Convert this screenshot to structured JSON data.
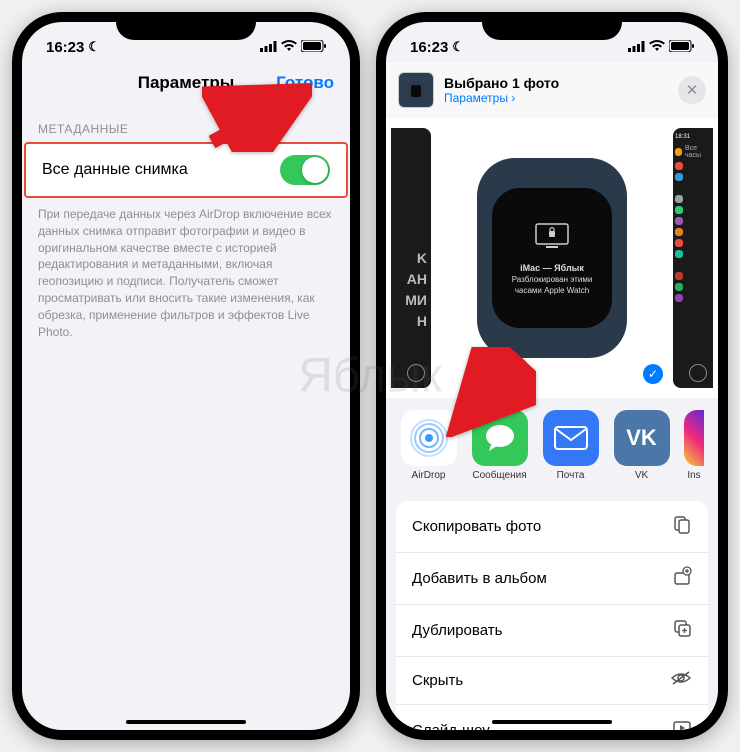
{
  "status": {
    "time": "16:23",
    "moon": "☾"
  },
  "left_phone": {
    "nav_title": "Параметры",
    "nav_done": "Готово",
    "section_header": "МЕТАДАННЫЕ",
    "toggle_label": "Все данные снимка",
    "toggle_on": true,
    "description": "При передаче данных через AirDrop включение всех данных снимка отправит фотографии и видео в оригинальном качестве вместе с историей редактирования и метаданными, включая геопозицию и подписи. Получатель сможет просматривать или вносить такие изменения, как обрезка, применение фильтров и эффектов Live Photo."
  },
  "right_phone": {
    "header_title": "Выбрано 1 фото",
    "header_link": "Параметры ›",
    "watch_title": "iMac — Яблык",
    "watch_text": "Разблокирован этими часами Apple Watch",
    "preview_left_text": "K\nАН\nМИ\nН",
    "apps": [
      {
        "label": "AirDrop",
        "icon_name": "airdrop-icon"
      },
      {
        "label": "Сообщения",
        "icon_name": "messages-icon"
      },
      {
        "label": "Почта",
        "icon_name": "mail-icon"
      },
      {
        "label": "VK",
        "icon_name": "vk-icon"
      },
      {
        "label": "Ins",
        "icon_name": "instagram-icon"
      }
    ],
    "actions": [
      {
        "label": "Скопировать фото",
        "icon": "⎘"
      },
      {
        "label": "Добавить в альбом",
        "icon": "⊕"
      },
      {
        "label": "Дублировать",
        "icon": "⊞"
      },
      {
        "label": "Скрыть",
        "icon": "◡"
      },
      {
        "label": "Слайд-шоу",
        "icon": "▷"
      }
    ]
  },
  "watermark": "Яблык",
  "colors": {
    "accent": "#007aff",
    "toggle_on": "#34c759",
    "highlight_border": "#e74c3c",
    "arrow": "#e01b24"
  }
}
